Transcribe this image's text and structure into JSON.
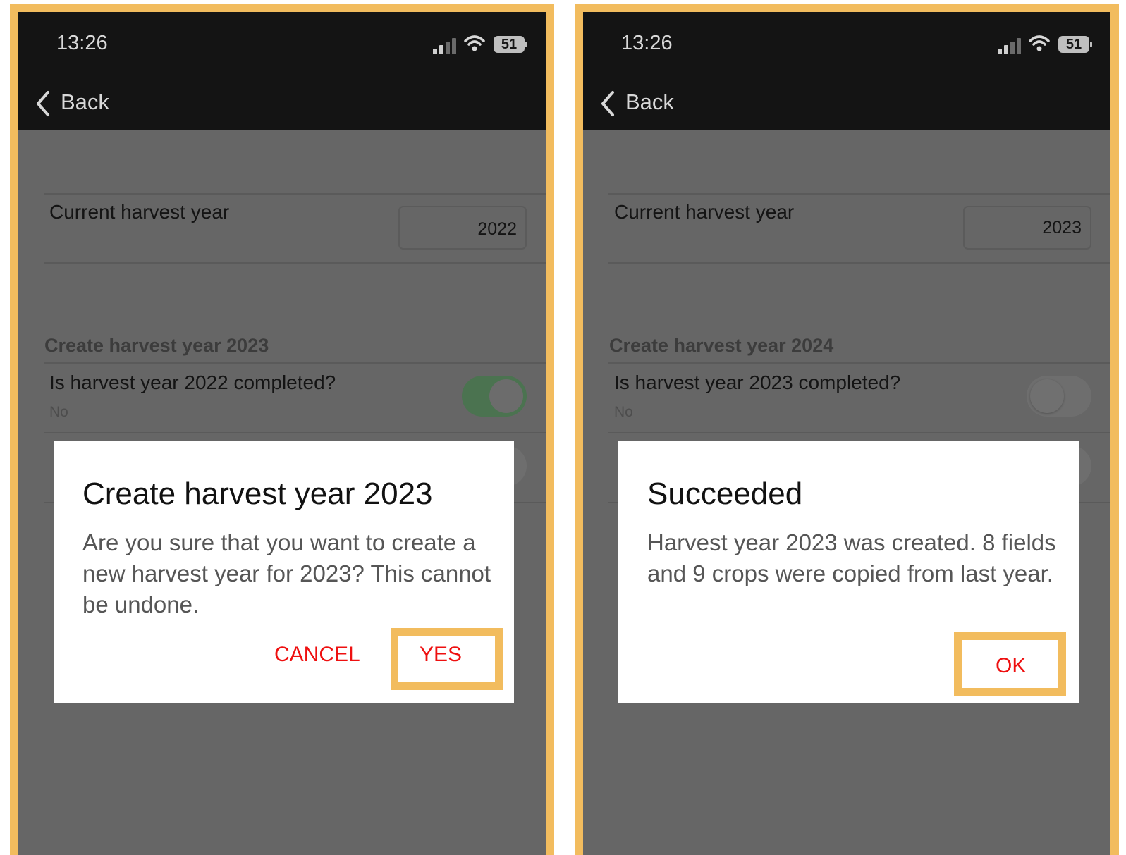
{
  "screens": [
    {
      "status_bar": {
        "time": "13:26",
        "battery": "51"
      },
      "nav": {
        "back_label": "Back"
      },
      "current_harvest_year": {
        "label": "Current harvest year",
        "value": "2022"
      },
      "create_section": {
        "title": "Create harvest year 2023"
      },
      "completed_question": {
        "label": "Is harvest year  2022 completed?",
        "sub": "No",
        "toggle_on": true
      },
      "dialog": {
        "title": "Create harvest year 2023",
        "body": "Are you sure that you want to create a new harvest year for 2023? This cannot be undone.",
        "cancel_label": "CANCEL",
        "confirm_label": "YES"
      }
    },
    {
      "status_bar": {
        "time": "13:26",
        "battery": "51"
      },
      "nav": {
        "back_label": "Back"
      },
      "current_harvest_year": {
        "label": "Current harvest year",
        "value": "2023"
      },
      "create_section": {
        "title": "Create harvest year 2024"
      },
      "completed_question": {
        "label": "Is harvest year 2023 completed?",
        "sub": "No",
        "toggle_on": false
      },
      "dialog": {
        "title": "Succeeded",
        "body": "Harvest year 2023 was created. 8 fields and 9 crops were copied from last year.",
        "ok_label": "OK"
      }
    }
  ],
  "colors": {
    "highlight": "#f2bc5e",
    "dialog_button": "#ee1010",
    "toggle_on": "#4b7350",
    "overlay": "#666666"
  }
}
